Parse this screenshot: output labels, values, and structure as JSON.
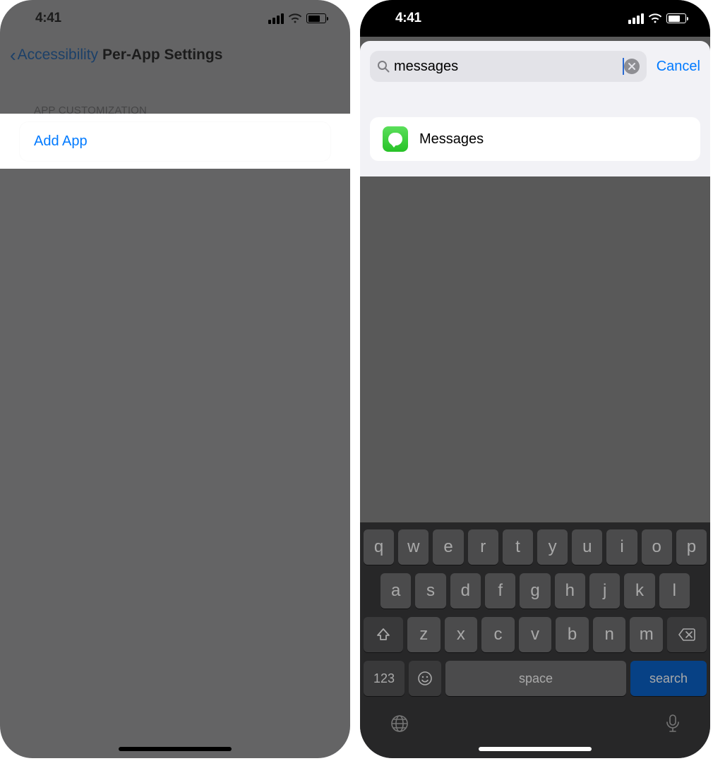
{
  "left": {
    "status_time": "4:41",
    "back_label": "Accessibility",
    "page_title": "Per-App Settings",
    "section_header": "APP CUSTOMIZATION",
    "add_app_label": "Add App"
  },
  "right": {
    "status_time": "4:41",
    "search_value": "messages",
    "cancel_label": "Cancel",
    "results": [
      {
        "icon": "messages-app-icon",
        "label": "Messages"
      }
    ],
    "keyboard": {
      "row1": [
        "q",
        "w",
        "e",
        "r",
        "t",
        "y",
        "u",
        "i",
        "o",
        "p"
      ],
      "row2": [
        "a",
        "s",
        "d",
        "f",
        "g",
        "h",
        "j",
        "k",
        "l"
      ],
      "row3": [
        "z",
        "x",
        "c",
        "v",
        "b",
        "n",
        "m"
      ],
      "key_123": "123",
      "key_space": "space",
      "key_search": "search"
    }
  }
}
